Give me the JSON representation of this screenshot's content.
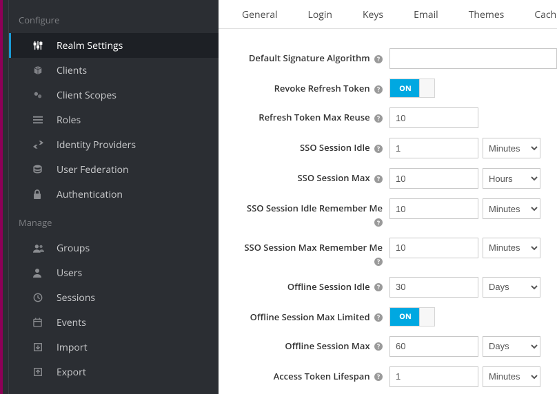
{
  "sidebar": {
    "sections": [
      {
        "heading": "Configure",
        "items": [
          {
            "id": "realm-settings",
            "label": "Realm Settings",
            "icon": "sliders",
            "active": true
          },
          {
            "id": "clients",
            "label": "Clients",
            "icon": "cube"
          },
          {
            "id": "client-scopes",
            "label": "Client Scopes",
            "icon": "scopes"
          },
          {
            "id": "roles",
            "label": "Roles",
            "icon": "list"
          },
          {
            "id": "identity-providers",
            "label": "Identity Providers",
            "icon": "exchange"
          },
          {
            "id": "user-federation",
            "label": "User Federation",
            "icon": "database"
          },
          {
            "id": "authentication",
            "label": "Authentication",
            "icon": "lock"
          }
        ]
      },
      {
        "heading": "Manage",
        "items": [
          {
            "id": "groups",
            "label": "Groups",
            "icon": "users"
          },
          {
            "id": "users",
            "label": "Users",
            "icon": "user"
          },
          {
            "id": "sessions",
            "label": "Sessions",
            "icon": "clock"
          },
          {
            "id": "events",
            "label": "Events",
            "icon": "calendar"
          },
          {
            "id": "import",
            "label": "Import",
            "icon": "import"
          },
          {
            "id": "export",
            "label": "Export",
            "icon": "export"
          }
        ]
      }
    ]
  },
  "tabs": [
    "General",
    "Login",
    "Keys",
    "Email",
    "Themes",
    "Cache"
  ],
  "toggle_on_label": "ON",
  "unit_options": [
    "Minutes",
    "Hours",
    "Days"
  ],
  "form": [
    {
      "label": "Default Signature Algorithm",
      "type": "wide",
      "value": ""
    },
    {
      "label": "Revoke Refresh Token",
      "type": "toggle",
      "on": true
    },
    {
      "label": "Refresh Token Max Reuse",
      "type": "num",
      "value": "10"
    },
    {
      "label": "SSO Session Idle",
      "type": "numunit",
      "value": "1",
      "unit": "Minutes"
    },
    {
      "label": "SSO Session Max",
      "type": "numunit",
      "value": "10",
      "unit": "Hours"
    },
    {
      "label": "SSO Session Idle Remember Me",
      "type": "numunit",
      "value": "10",
      "unit": "Minutes",
      "wrap": true
    },
    {
      "label": "SSO Session Max Remember Me",
      "type": "numunit",
      "value": "10",
      "unit": "Minutes",
      "wrap": true
    },
    {
      "label": "Offline Session Idle",
      "type": "numunit",
      "value": "30",
      "unit": "Days"
    },
    {
      "label": "Offline Session Max Limited",
      "type": "toggle",
      "on": true
    },
    {
      "label": "Offline Session Max",
      "type": "numunit",
      "value": "60",
      "unit": "Days"
    },
    {
      "label": "Access Token Lifespan",
      "type": "numunit",
      "value": "1",
      "unit": "Minutes"
    }
  ]
}
